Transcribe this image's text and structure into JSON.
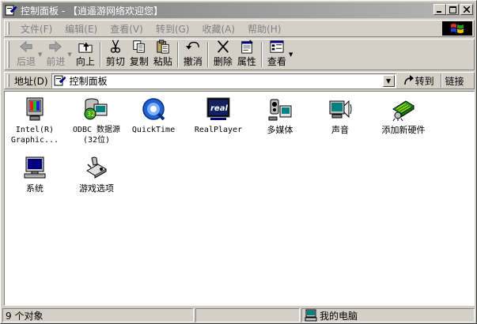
{
  "window": {
    "title": "控制面板 - 【逍遥游网络欢迎您】"
  },
  "menu": [
    {
      "label": "文件(F)",
      "icon": ""
    },
    {
      "label": "编辑(E)",
      "icon": ""
    },
    {
      "label": "查看(V)",
      "icon": ""
    },
    {
      "label": "转到(G)",
      "icon": ""
    },
    {
      "label": "收藏(A)",
      "icon": ""
    },
    {
      "label": "帮助(H)",
      "icon": ""
    }
  ],
  "toolbar": {
    "back": "后退",
    "forward": "前进",
    "up": "向上",
    "cut": "剪切",
    "copy": "复制",
    "paste": "粘贴",
    "undo": "撤消",
    "delete": "删除",
    "properties": "属性",
    "view": "查看"
  },
  "address": {
    "label": "地址(D)",
    "value": "控制面板",
    "go": "转到",
    "links": "链接"
  },
  "items": [
    {
      "label": "Intel(R)\nGraphic...",
      "icon": "intel-graphics-icon"
    },
    {
      "label": "ODBC 数据源\n(32位)",
      "icon": "odbc-icon"
    },
    {
      "label": "QuickTime",
      "icon": "quicktime-icon"
    },
    {
      "label": "RealPlayer",
      "icon": "realplayer-icon"
    },
    {
      "label": "多媒体",
      "icon": "multimedia-icon"
    },
    {
      "label": "声音",
      "icon": "sound-icon"
    },
    {
      "label": "添加新硬件",
      "icon": "add-hardware-icon"
    },
    {
      "label": "系统",
      "icon": "system-icon"
    },
    {
      "label": "游戏选项",
      "icon": "game-controller-icon"
    }
  ],
  "status": {
    "count": "9 个对象",
    "location": "我的电脑"
  }
}
